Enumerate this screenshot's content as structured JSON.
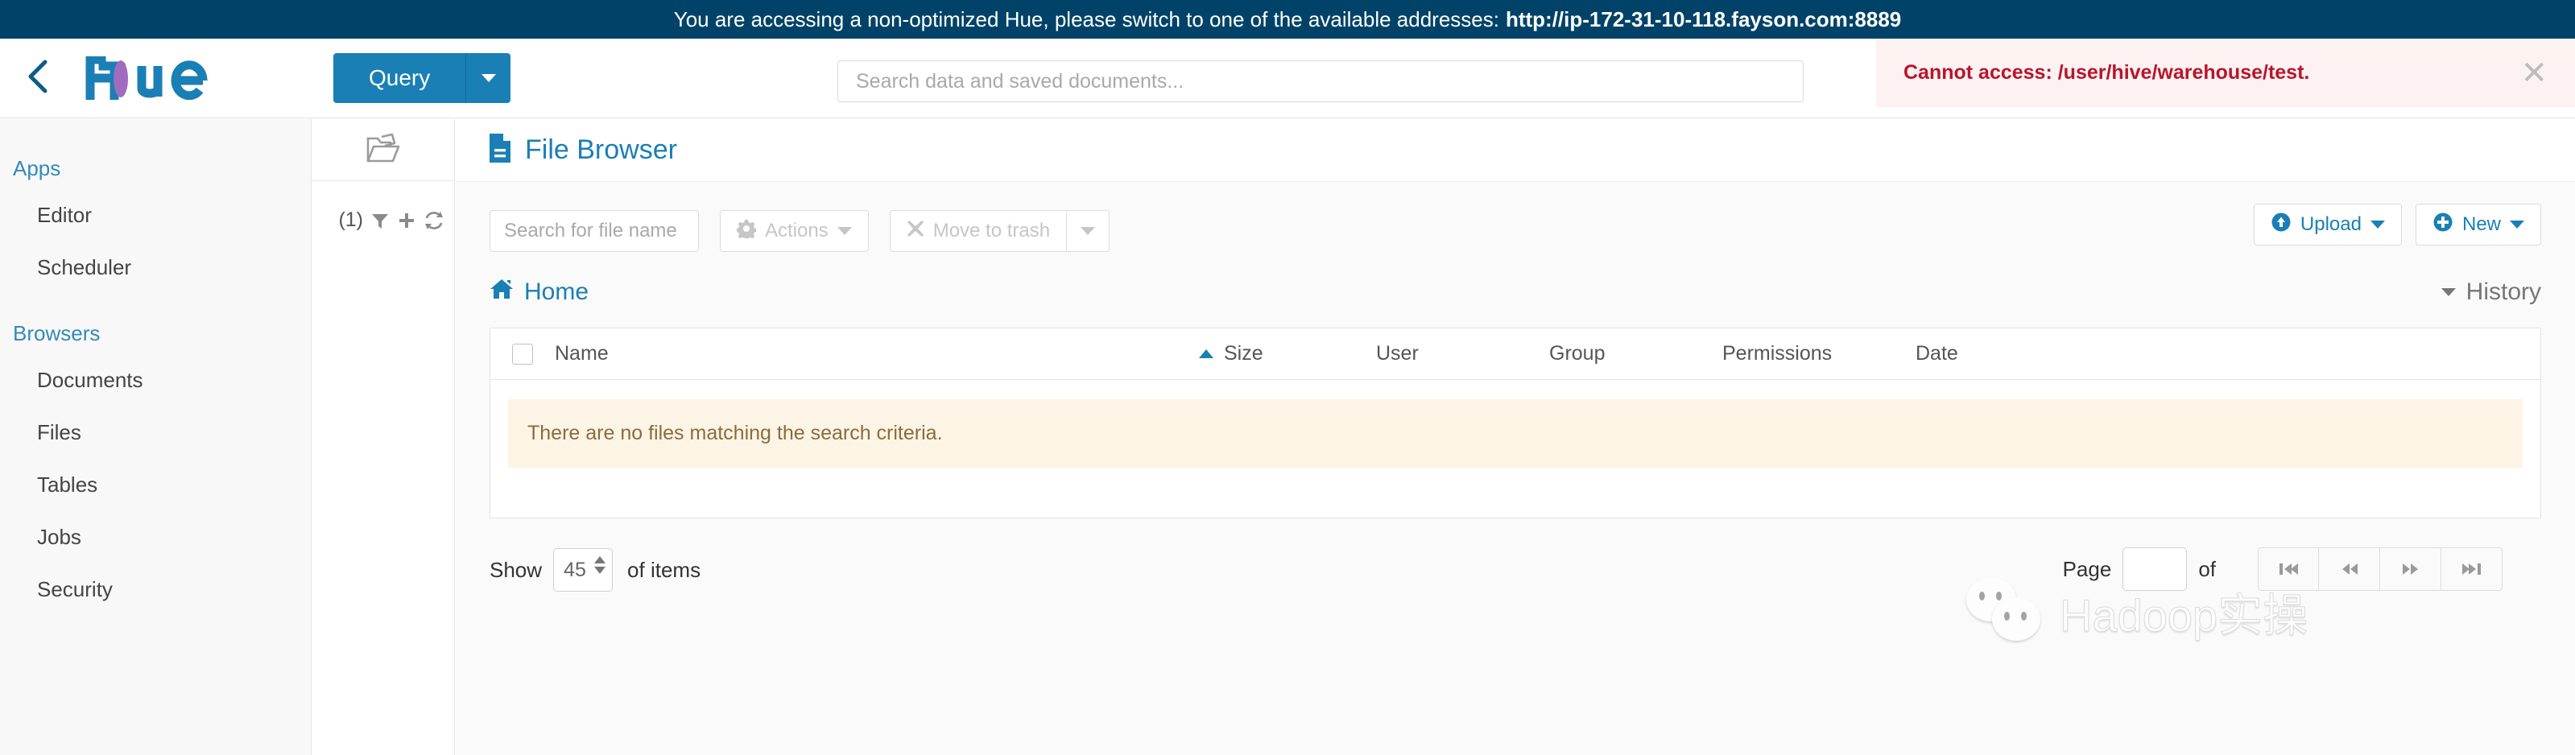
{
  "notice": {
    "message": "You are accessing a non-optimized Hue, please switch to one of the available addresses:",
    "url": "http://ip-172-31-10-118.fayson.com:8889",
    "bg_color": "#014368"
  },
  "navbar": {
    "back_icon": "chevron-left-icon",
    "logo_text": "hue",
    "query_button": "Query",
    "query_caret_icon": "caret-down-icon",
    "accent_color": "#1a7fb5"
  },
  "search": {
    "placeholder": "Search data and saved documents...",
    "value": ""
  },
  "error_toast": {
    "message": "Cannot access: /user/hive/warehouse/test.",
    "close_icon": "close-icon",
    "text_color": "#b9152b",
    "bg_color": "#fdf2f2"
  },
  "sidebar": {
    "groups": [
      {
        "title": "Apps",
        "items": [
          {
            "label": "Editor"
          },
          {
            "label": "Scheduler"
          }
        ]
      },
      {
        "title": "Browsers",
        "items": [
          {
            "label": "Documents"
          },
          {
            "label": "Files"
          },
          {
            "label": "Tables"
          },
          {
            "label": "Jobs"
          },
          {
            "label": "Security"
          }
        ]
      }
    ]
  },
  "assist": {
    "folder_icon": "folder-open-icon",
    "count": "(1)",
    "filter_icon": "filter-icon",
    "add_icon": "plus-icon",
    "refresh_icon": "refresh-icon"
  },
  "page": {
    "icon": "file-document-icon",
    "title": "File Browser"
  },
  "toolbar": {
    "file_search_placeholder": "Search for file name",
    "file_search_value": "",
    "actions_label": "Actions",
    "actions_icon": "gear-icon",
    "trash_label": "Move to trash",
    "trash_icon": "times-icon",
    "trash_caret_icon": "caret-down-icon",
    "upload_label": "Upload",
    "upload_icon": "circle-arrow-up-icon",
    "new_label": "New",
    "new_icon": "circle-plus-icon"
  },
  "breadcrumb": {
    "home_label": "Home",
    "home_icon": "home-icon",
    "history_label": "History",
    "history_icon": "caret-down-icon"
  },
  "table": {
    "columns": [
      {
        "label": "Name",
        "sorted": "asc"
      },
      {
        "label": "Size"
      },
      {
        "label": "User"
      },
      {
        "label": "Group"
      },
      {
        "label": "Permissions"
      },
      {
        "label": "Date"
      }
    ],
    "empty_message": "There are no files matching the search criteria.",
    "empty_bg_color": "#fcf5e6",
    "empty_text_color": "#8a6d3b",
    "rows": []
  },
  "pagination": {
    "show_label": "Show",
    "page_size": "45",
    "of_items_label": "of items",
    "page_label": "Page",
    "page_value": "",
    "of_label": "of",
    "total_pages": "",
    "first_icon": "skip-to-first-icon",
    "prev_icon": "rewind-icon",
    "next_icon": "fast-forward-icon",
    "last_icon": "skip-to-last-icon"
  },
  "watermark": {
    "text": "Hadoop实操",
    "icon": "wechat-icon"
  }
}
